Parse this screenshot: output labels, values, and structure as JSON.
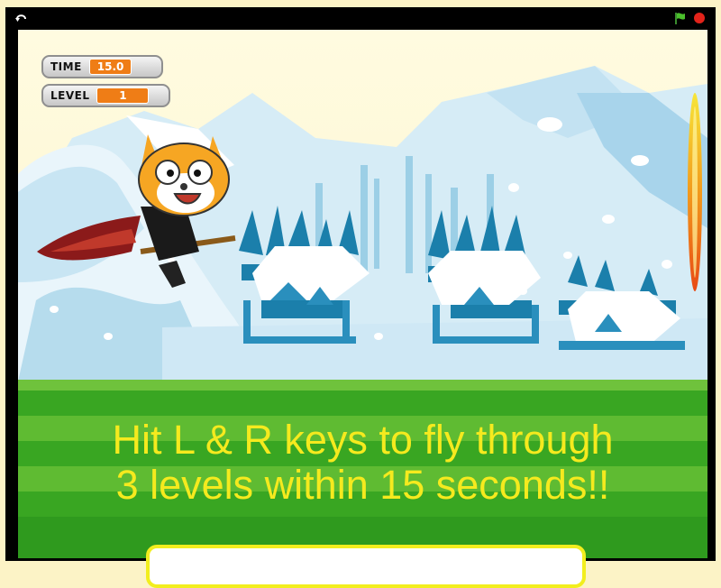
{
  "game": {
    "time_label": "TIME",
    "time_value": "15.0",
    "level_label": "LEVEL",
    "level_value": "1",
    "instructions_line1": "Hit L & R keys to fly through",
    "instructions_line2": "3 levels within 15 seconds!!"
  },
  "controls": {
    "fullscreen_icon": "arrow-return-icon",
    "green_flag_icon": "green-flag-icon",
    "stop_icon": "red-stop-icon"
  },
  "colors": {
    "instruction_text": "#f5ea1e",
    "monitor_value_bg": "#ef7d16",
    "frame": "#000000",
    "grass": "#39a622"
  }
}
